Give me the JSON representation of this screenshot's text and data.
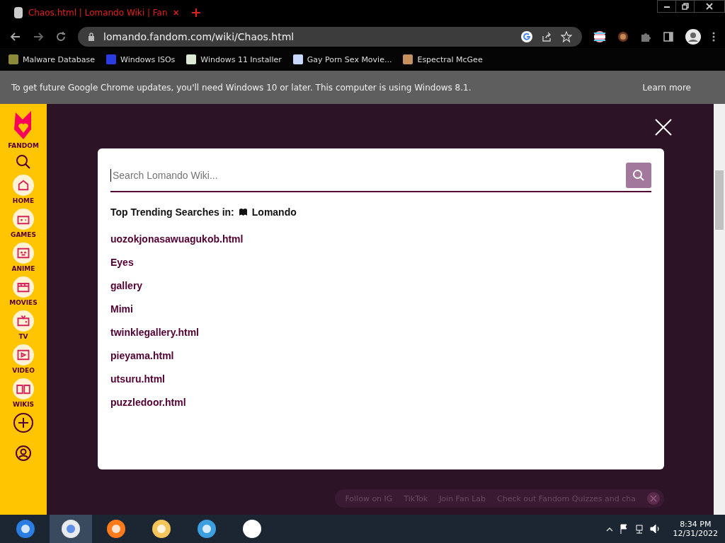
{
  "browser": {
    "tab": {
      "title": "Chaos.html | Lomando Wiki | Fan"
    },
    "address": "lomando.fandom.com/wiki/Chaos.html",
    "bookmarks": [
      "Malware Database",
      "Windows ISOs",
      "Windows 11 Installer",
      "Gay Porn Sex Movie...",
      "Espectral McGee"
    ],
    "infobar": {
      "message": "To get future Google Chrome updates, you'll need Windows 10 or later. This computer is using Windows 8.1.",
      "link": "Learn more"
    }
  },
  "sidebar": {
    "brand": "FANDOM",
    "items": [
      {
        "label": "HOME"
      },
      {
        "label": "GAMES"
      },
      {
        "label": "ANIME"
      },
      {
        "label": "MOVIES"
      },
      {
        "label": "TV"
      },
      {
        "label": "VIDEO"
      },
      {
        "label": "WIKIS"
      }
    ]
  },
  "search_modal": {
    "placeholder": "Search Lomando Wiki...",
    "trending_label": "Top Trending Searches in:",
    "community": "Lomando",
    "results": [
      "uozokjonasawuagukob.html",
      "Eyes",
      "gallery",
      "Mimi",
      "twinklegallery.html",
      "pieyama.html",
      "utsuru.html",
      "puzzledoor.html"
    ]
  },
  "footer_links": [
    "Follow on IG",
    "TikTok",
    "Join Fan Lab",
    "Check out Fandom Quizzes and cha"
  ],
  "taskbar": {
    "apps": [
      {
        "selected": false
      },
      {
        "selected": true
      },
      {
        "selected": false
      },
      {
        "selected": false
      },
      {
        "selected": false
      },
      {
        "selected": false
      }
    ],
    "time": "8:34 PM",
    "date": "12/31/2022"
  }
}
